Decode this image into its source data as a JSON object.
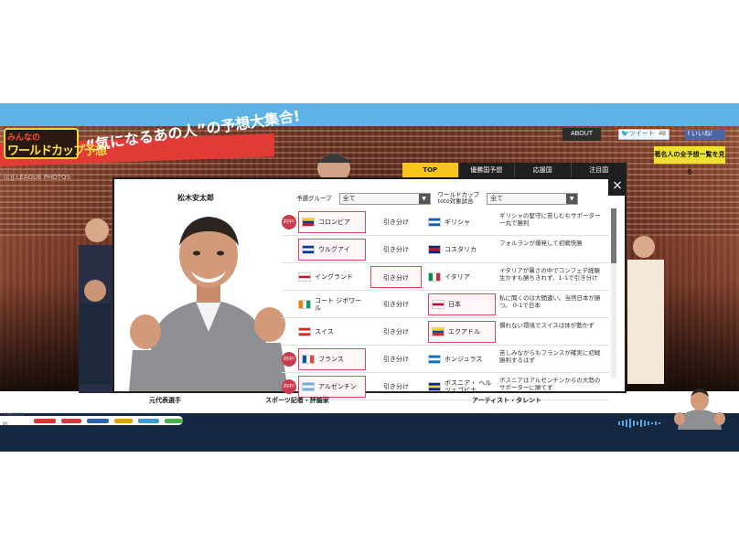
{
  "header": {
    "logo_top": "みんなの",
    "logo_main": "ワールドカップ予想",
    "headline": "“気になるあの人”の予想大集合!",
    "photo_credit": "(c)J.LEAGUE PHOTOS",
    "about": "ABOUT",
    "tweet": "ツイート",
    "tweet_count": "48",
    "like": "いいね!",
    "all_picks": "著名人の全予想一覧を見る"
  },
  "tabs": [
    {
      "label": "TOP"
    },
    {
      "label": "優勝国予想"
    },
    {
      "label": "応援国"
    },
    {
      "label": "注目国"
    }
  ],
  "person": {
    "name": "松木安太郎"
  },
  "filters": {
    "group_label": "予選グループ",
    "group_value": "全て",
    "match_label_line1": "ワールドカップ",
    "match_label_line2": "toto対象試合",
    "match_value": "全て"
  },
  "badge_text": "的中!",
  "matches": [
    {
      "home": "コロンビア",
      "result": "引き分け",
      "away": "ギリシャ",
      "comment": "ギリシャの堅守に苦しむもサポーター一丸で勝利",
      "pick": "home",
      "hit": true,
      "home_flag": [
        "#fcd116",
        "#003893",
        "#ce1126"
      ],
      "away_flag": [
        "#0d5eaf",
        "#ffffff",
        "#0d5eaf"
      ]
    },
    {
      "home": "ウルグアイ",
      "result": "引き分け",
      "away": "コスタリカ",
      "comment": "フォルランが爆発して初戦快勝",
      "pick": "home",
      "hit": false,
      "home_flag": [
        "#0038a8",
        "#ffffff",
        "#0038a8"
      ],
      "away_flag": [
        "#002b7f",
        "#ce1126",
        "#002b7f"
      ]
    },
    {
      "home": "イングランド",
      "result": "引き分け",
      "away": "イタリア",
      "comment": "イタリアが暑さの中でコンフェデ経験生かすも勝ちきれず、1-1で引き分け",
      "pick": "draw",
      "hit": false,
      "home_flag": [
        "#ffffff",
        "#ce1124",
        "#ffffff"
      ],
      "away_flag": [
        "#009246",
        "#ffffff",
        "#ce2b37"
      ]
    },
    {
      "home": "コート ジボワール",
      "result": "引き分け",
      "away": "日本",
      "comment": "私に聞くのは大間違い。当然日本が勝つ。 0-1で日本",
      "pick": "away",
      "hit": false,
      "home_flag": [
        "#f77f00",
        "#ffffff",
        "#009e60"
      ],
      "away_flag": [
        "#ffffff",
        "#bc002d",
        "#ffffff"
      ]
    },
    {
      "home": "スイス",
      "result": "引き分け",
      "away": "エクアドル",
      "comment": "慣れない環境でスイスは体が動かず",
      "pick": "away",
      "hit": false,
      "home_flag": [
        "#d52b1e",
        "#ffffff",
        "#d52b1e"
      ],
      "away_flag": [
        "#ffdd00",
        "#034ea2",
        "#ed1c24"
      ]
    },
    {
      "home": "フランス",
      "result": "引き分け",
      "away": "ホンジュラス",
      "comment": "苦しみながらもフランスが確実に初戦勝利するはず",
      "pick": "home",
      "hit": true,
      "home_flag": [
        "#0055a4",
        "#ffffff",
        "#ef4135"
      ],
      "away_flag": [
        "#0073cf",
        "#ffffff",
        "#0073cf"
      ]
    },
    {
      "home": "アルゼンチン",
      "result": "引き分け",
      "away": "ボスニア・ ヘルツェゴビナ",
      "comment": "ボスニアはアルゼンチンからの大勢のサポーターに勝てず",
      "pick": "home",
      "hit": true,
      "home_flag": [
        "#74acdf",
        "#ffffff",
        "#74acdf"
      ],
      "away_flag": [
        "#002395",
        "#fecb00",
        "#002395"
      ]
    }
  ],
  "categories": {
    "former_players": "元代表選手",
    "journalists": "スポーツ記者・評論家",
    "artists": "アーティスト・タレント"
  },
  "footer": {
    "powered": "POWERED BY"
  },
  "colors": {
    "accent_red": "#e23b36",
    "tab_active": "#f7c51e",
    "navy": "#152841",
    "pick_border": "#d8495f",
    "sky": "#5db3e6"
  }
}
